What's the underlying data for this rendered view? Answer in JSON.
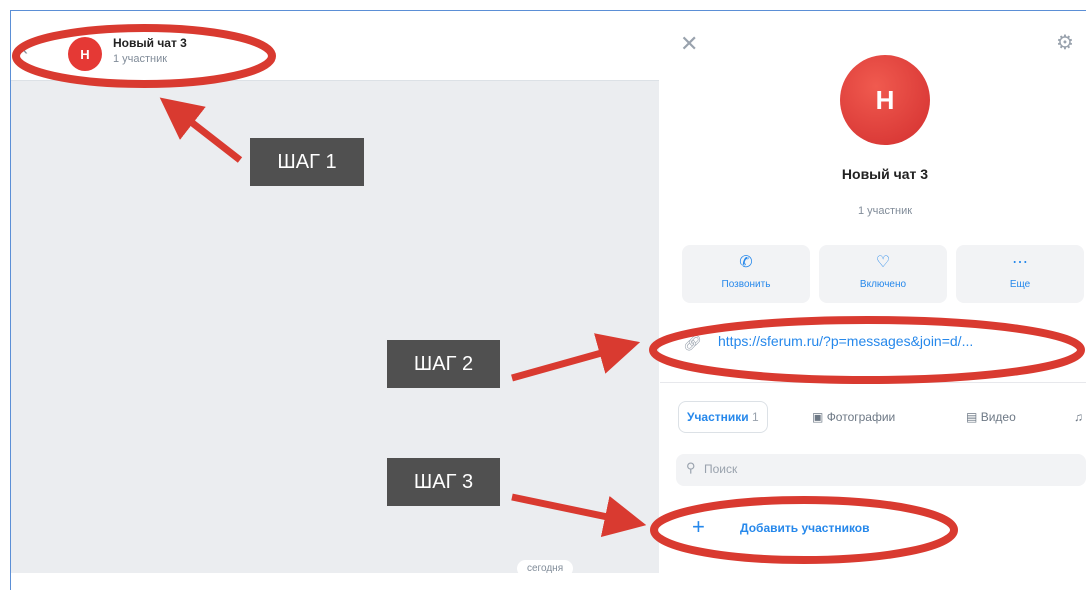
{
  "chat": {
    "back_icon": "chevron-left-icon",
    "avatar_letter": "Н",
    "title": "Новый чат 3",
    "subtitle": "1 участник",
    "date_chip": "сегодня"
  },
  "panel": {
    "close_icon": "close-icon",
    "settings_icon": "gear-icon",
    "avatar_letter": "Н",
    "title": "Новый чат 3",
    "subtitle": "1 участник",
    "actions": [
      {
        "label": "Позвонить",
        "icon": "phone-icon"
      },
      {
        "label": "Включено",
        "icon": "bell-icon"
      },
      {
        "label": "Еще",
        "icon": "more-icon"
      }
    ],
    "invite_link": "https://sferum.ru/?p=messages&join=d/...",
    "tabs": [
      {
        "label": "Участники",
        "count": "1"
      },
      {
        "label": "Фотографии"
      },
      {
        "label": "Видео"
      }
    ],
    "search_placeholder": "Поиск",
    "add_members": "Добавить участников"
  },
  "annotations": {
    "step1": "ШАГ 1",
    "step2": "ШАГ 2",
    "step3": "ШАГ 3",
    "color": "#d93a30"
  }
}
